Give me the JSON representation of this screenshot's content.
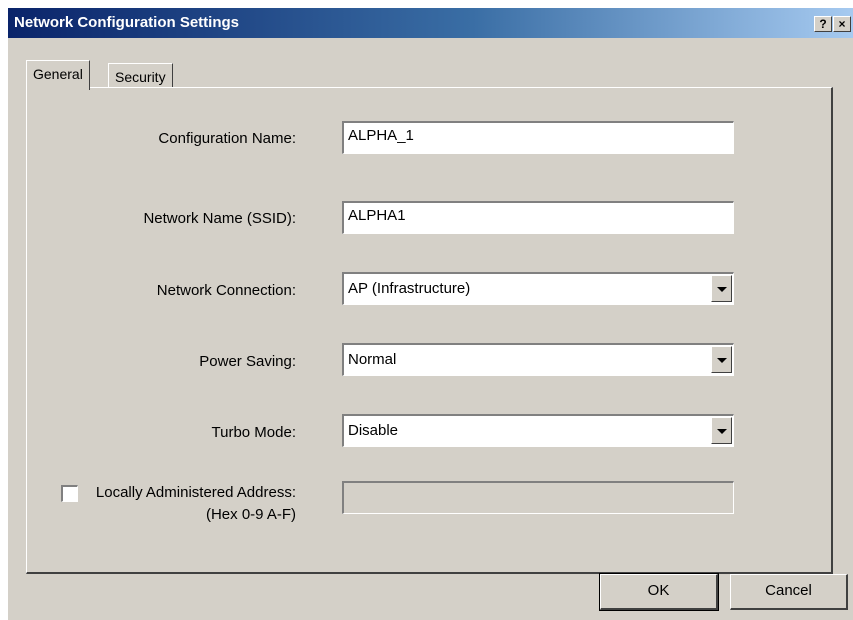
{
  "window": {
    "title": "Network Configuration Settings",
    "help_label": "?",
    "close_label": "×"
  },
  "tabs": [
    {
      "label": "General",
      "active": true
    },
    {
      "label": "Security",
      "active": false
    }
  ],
  "form": {
    "config_name": {
      "label": "Configuration Name:",
      "value": "ALPHA_1"
    },
    "ssid": {
      "label": "Network Name (SSID):",
      "value": "ALPHA1"
    },
    "connection": {
      "label": "Network Connection:",
      "value": "AP (Infrastructure)"
    },
    "power_saving": {
      "label": "Power Saving:",
      "value": "Normal"
    },
    "turbo_mode": {
      "label": "Turbo Mode:",
      "value": "Disable"
    },
    "local_address": {
      "label": "Locally Administered Address:",
      "sublabel": "(Hex 0-9 A-F)",
      "checked": false,
      "value": ""
    }
  },
  "buttons": {
    "ok": "OK",
    "cancel": "Cancel"
  }
}
